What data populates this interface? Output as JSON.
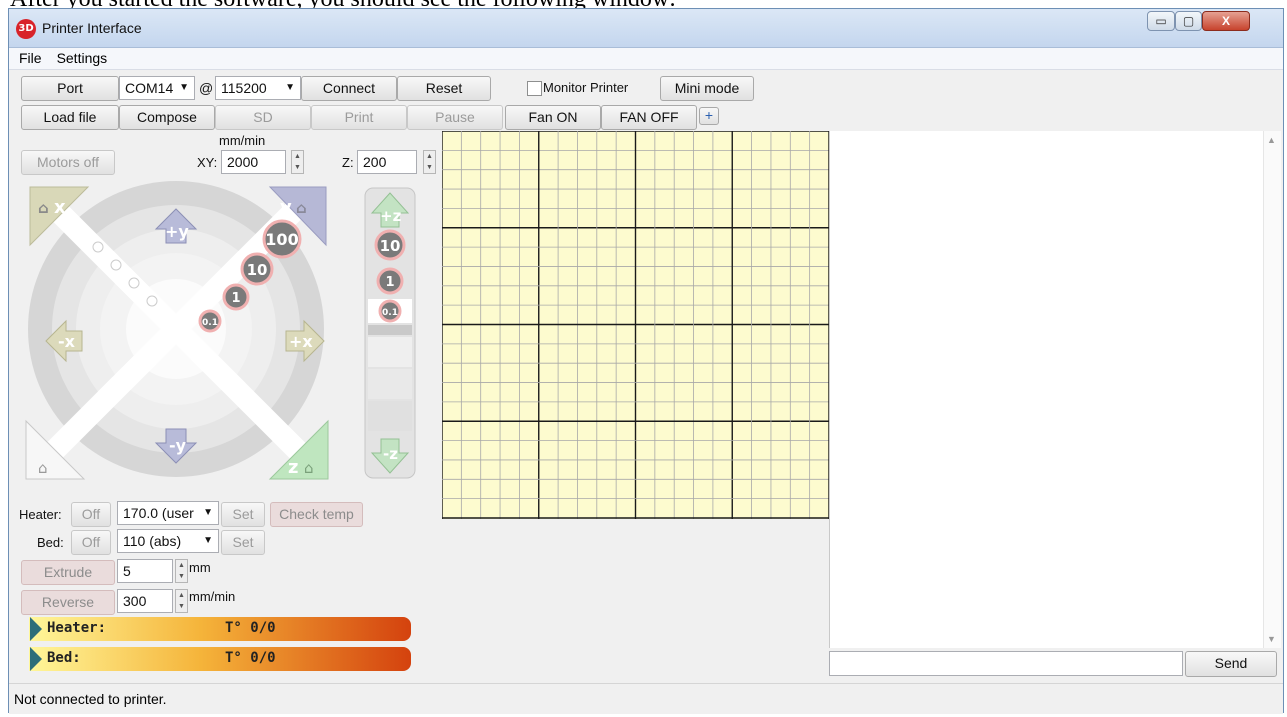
{
  "doc_text": "After you started the software, you should see the following window:",
  "window": {
    "title": "Printer Interface",
    "app_icon_text": "3D",
    "controls": {
      "minimize": "▭",
      "maximize": "▢",
      "close": "X"
    }
  },
  "menu": [
    "File",
    "Settings"
  ],
  "toolbar1": {
    "port_button": "Port",
    "port_value": "COM14",
    "at": "@",
    "baud_value": "115200",
    "connect_button": "Connect",
    "reset_button": "Reset",
    "monitor_label": "Monitor Printer",
    "mini_mode_button": "Mini mode"
  },
  "toolbar2": {
    "load_file": "Load file",
    "compose": "Compose",
    "sd": "SD",
    "print": "Print",
    "pause": "Pause",
    "fan_on": "Fan ON",
    "fan_off": "FAN OFF",
    "plus": "+"
  },
  "motion": {
    "motors_off": "Motors off",
    "unit": "mm/min",
    "xy_label": "XY:",
    "xy_value": "2000",
    "z_label": "Z:",
    "z_value": "200"
  },
  "jog": {
    "home_x": "x",
    "home_y": "y",
    "home_z": "z",
    "plus_y": "+y",
    "minus_y": "-y",
    "plus_x": "+x",
    "minus_x": "-x",
    "plus_z": "+z",
    "minus_z": "-z",
    "steps_xy": [
      "100",
      "10",
      "1",
      "0.1"
    ],
    "steps_z": [
      "10",
      "1",
      "0.1"
    ]
  },
  "temps": {
    "heater_label": "Heater:",
    "heater_off": "Off",
    "heater_value": "170.0 (user",
    "set": "Set",
    "check_temp": "Check temp",
    "bed_label": "Bed:",
    "bed_off": "Off",
    "bed_value": "110 (abs)"
  },
  "extrude": {
    "extrude_button": "Extrude",
    "extrude_value": "5",
    "extrude_unit": "mm",
    "reverse_button": "Reverse",
    "reverse_value": "300",
    "reverse_unit": "mm/min"
  },
  "gauges": {
    "heater_label": "Heater:",
    "heater_value": "T° 0/0",
    "bed_label": "Bed:",
    "bed_value": "T° 0/0"
  },
  "console": {
    "send_button": "Send",
    "input_value": ""
  },
  "status": "Not connected to printer.",
  "colors": {
    "grid_bg": "#fdfbcf",
    "accent_red": "#d4420e"
  }
}
